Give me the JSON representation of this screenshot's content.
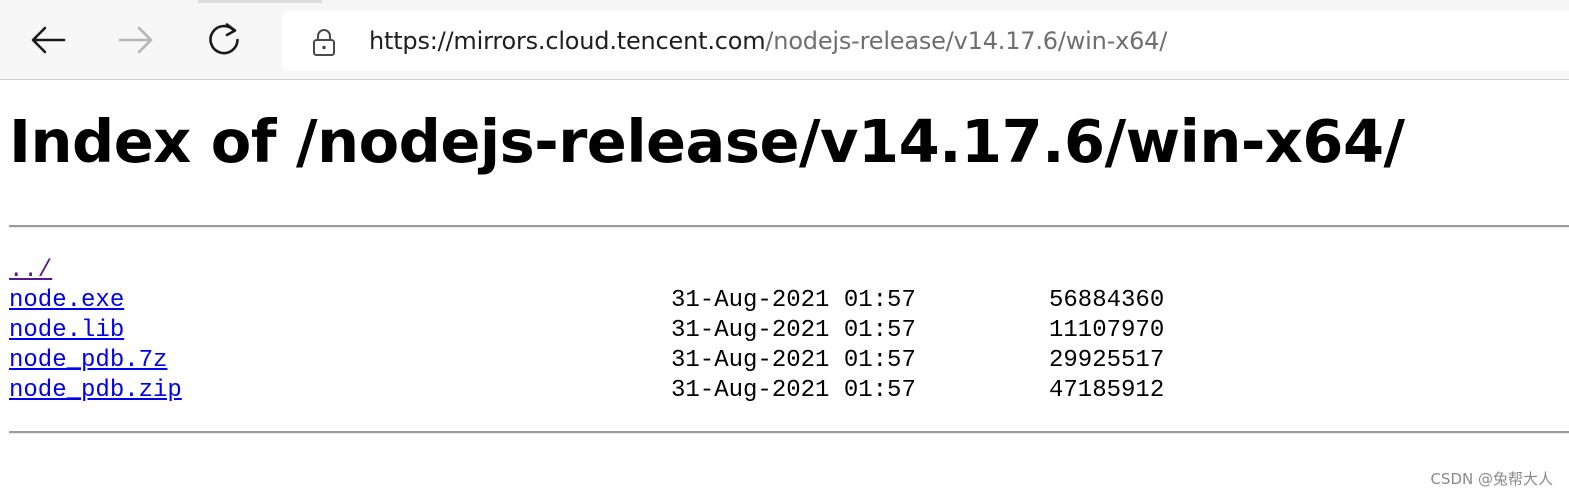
{
  "browser": {
    "address_bar": {
      "url_host": "https://mirrors.cloud.tencent.com",
      "url_path": "/nodejs-release/v14.17.6/win-x64/"
    },
    "icons": {
      "back": "arrow-left-icon",
      "forward": "arrow-right-icon",
      "reload": "reload-icon",
      "security": "lock-icon"
    }
  },
  "page": {
    "title": "Index of /nodejs-release/v14.17.6/win-x64/",
    "parent_link": "../",
    "files": [
      {
        "name": "node.exe",
        "date": "31-Aug-2021 01:57",
        "size": "56884360"
      },
      {
        "name": "node.lib",
        "date": "31-Aug-2021 01:57",
        "size": "11107970"
      },
      {
        "name": "node_pdb.7z",
        "date": "31-Aug-2021 01:57",
        "size": "29925517"
      },
      {
        "name": "node_pdb.zip",
        "date": "31-Aug-2021 01:57",
        "size": "47185912"
      }
    ]
  },
  "watermark": "CSDN @兔帮大人",
  "colors": {
    "link": "#0000ee",
    "visited_link": "#551a8b",
    "toolbar_bg": "#f7f7f7"
  }
}
